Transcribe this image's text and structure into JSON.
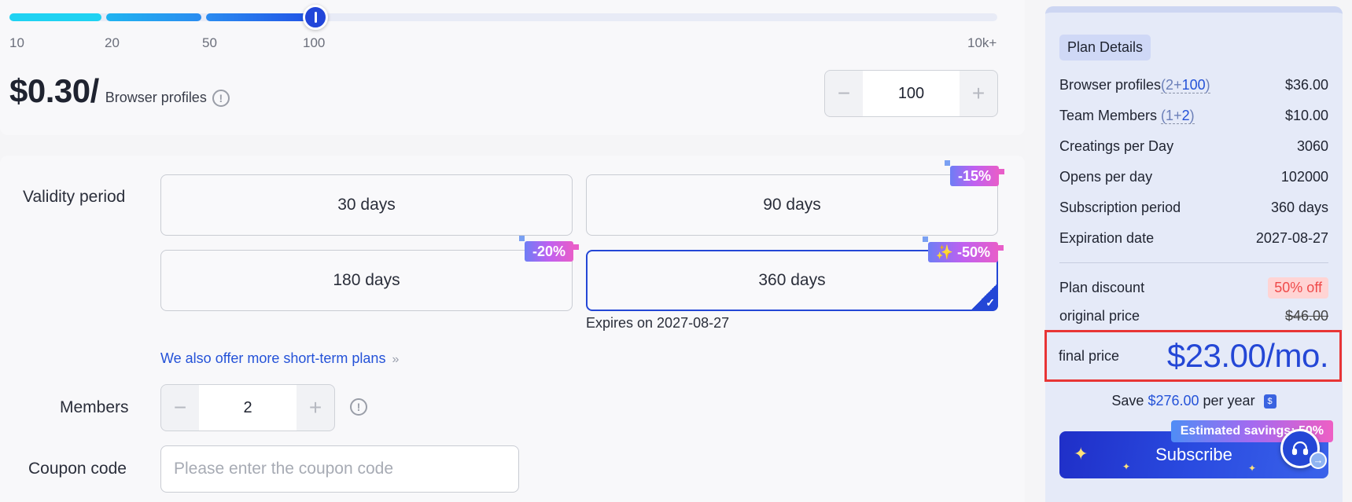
{
  "slider": {
    "ticks": [
      "10",
      "20",
      "50",
      "100",
      "10k+"
    ],
    "value": 100
  },
  "price": {
    "amount": "$0.30/",
    "unit": "Browser profiles",
    "info_icon": "info-circle-icon"
  },
  "profiles_stepper": {
    "minus": "−",
    "value": "100",
    "plus": "+"
  },
  "validity": {
    "label": "Validity period",
    "options": [
      {
        "label": "30 days",
        "badge": ""
      },
      {
        "label": "90 days",
        "badge": "-15%"
      },
      {
        "label": "180 days",
        "badge": "-20%"
      },
      {
        "label": "360 days",
        "badge": "✨ -50%",
        "selected": true
      }
    ],
    "expires": "Expires on 2027-08-27",
    "short_term_link": "We also offer more short-term plans",
    "link_chevron": "»"
  },
  "members": {
    "label": "Members",
    "minus": "−",
    "value": "2",
    "plus": "+"
  },
  "coupon": {
    "label": "Coupon code",
    "placeholder": "Please enter the coupon code"
  },
  "plan_details": {
    "title": "Plan Details",
    "browser_profiles": {
      "label": "Browser profiles",
      "detail_open": "(",
      "base": "2",
      "plus": "+",
      "extra": "100",
      "detail_close": ")",
      "value": "$36.00"
    },
    "team_members": {
      "label": "Team Members",
      "detail_open": "(",
      "base": "1",
      "plus": "+",
      "extra": "2",
      "detail_close": ")",
      "value": "$10.00"
    },
    "creatings": {
      "label": "Creatings per Day",
      "value": "3060"
    },
    "opens": {
      "label": "Opens per day",
      "value": "102000"
    },
    "subscription_period": {
      "label": "Subscription period",
      "value": "360 days"
    },
    "expiration": {
      "label": "Expiration date",
      "value": "2027-08-27"
    },
    "discount": {
      "label": "Plan discount",
      "value": "50% off"
    },
    "original_price": {
      "label": "original price",
      "value": "$46.00"
    },
    "final_price": {
      "label": "final price",
      "value": "$23.00/mo."
    },
    "save": {
      "prefix": "Save",
      "amount": "$276.00",
      "suffix": "per year",
      "icon": "$"
    },
    "subscribe_label": "Subscribe",
    "estimated_savings": "Estimated savings: 50%"
  },
  "colors": {
    "accent": "#2447d6",
    "highlight_border": "#e83535",
    "discount_red": "#ef4a4a"
  }
}
